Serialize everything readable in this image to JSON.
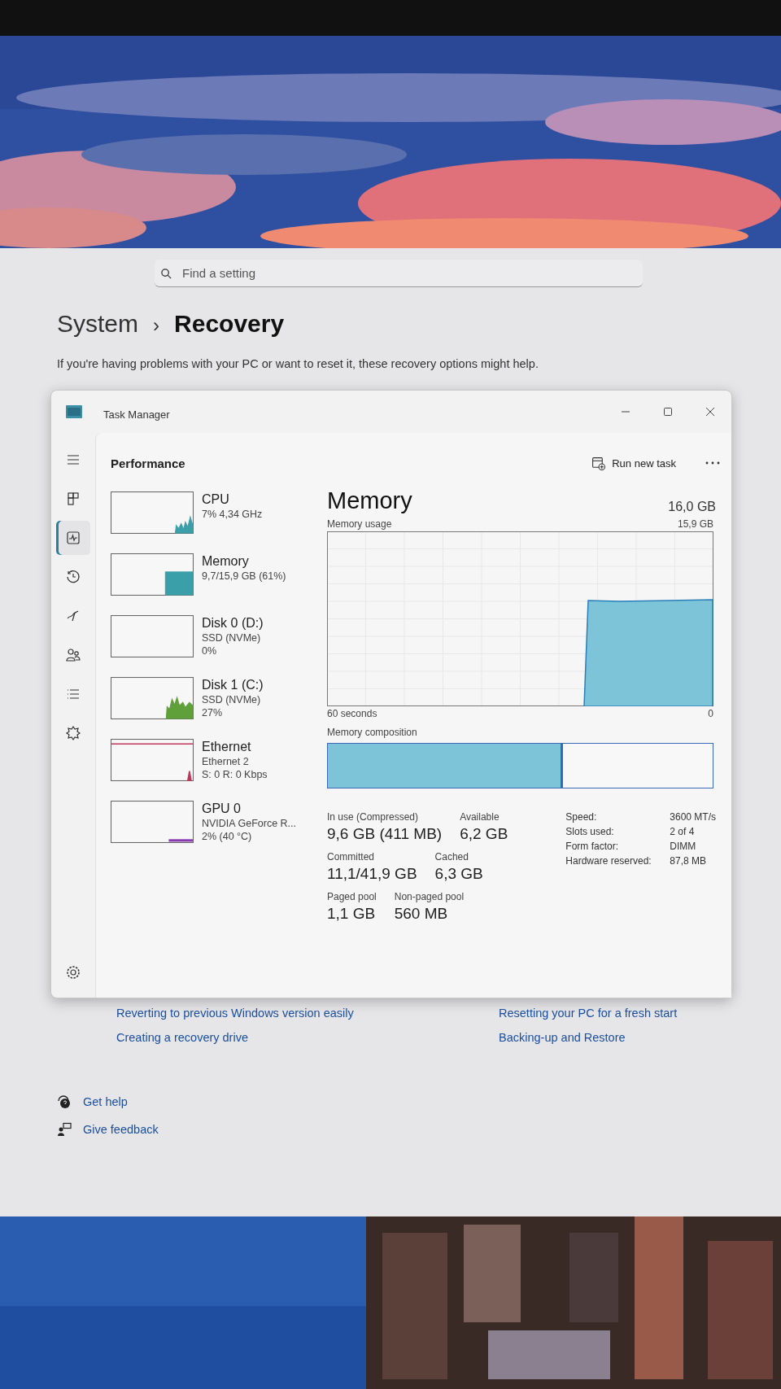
{
  "settings": {
    "search": {
      "placeholder": "Find a setting"
    },
    "breadcrumb": {
      "parent": "System",
      "separator": "›",
      "current": "Recovery"
    },
    "description": "If you're having problems with your PC or want to reset it, these recovery options might help.",
    "related_links": [
      {
        "label": "Reverting to previous Windows version easily"
      },
      {
        "label": "Resetting your PC for a fresh start"
      },
      {
        "label": "Creating a recovery drive"
      },
      {
        "label": "Backing-up and Restore"
      }
    ],
    "help_links": [
      {
        "kind": "help",
        "label": "Get help"
      },
      {
        "kind": "feedback",
        "label": "Give feedback"
      }
    ]
  },
  "task_manager": {
    "title": "Task Manager",
    "nav": [
      {
        "kind": "menu",
        "selected": false
      },
      {
        "kind": "processes",
        "selected": false
      },
      {
        "kind": "performance",
        "selected": true
      },
      {
        "kind": "history",
        "selected": false
      },
      {
        "kind": "startup",
        "selected": false
      },
      {
        "kind": "users",
        "selected": false
      },
      {
        "kind": "details",
        "selected": false
      },
      {
        "kind": "services",
        "selected": false
      }
    ],
    "nav_bottom": {
      "kind": "settings",
      "selected": false
    },
    "page_title": "Performance",
    "run_task": "Run new task",
    "resources": [
      {
        "name": "CPU",
        "lines": [
          "7% 4,34 GHz"
        ],
        "kind": "spikes",
        "color": "#3a9fa8"
      },
      {
        "name": "Memory",
        "lines": [
          "9,7/15,9 GB (61%)"
        ],
        "kind": "block",
        "color": "#3a9fa8"
      },
      {
        "name": "Disk 0 (D:)",
        "lines": [
          "SSD (NVMe)",
          "0%"
        ],
        "kind": "empty"
      },
      {
        "name": "Disk 1 (C:)",
        "lines": [
          "SSD (NVMe)",
          "27%"
        ],
        "kind": "mountain",
        "color": "#5fa03a"
      },
      {
        "name": "Ethernet",
        "lines": [
          "Ethernet 2",
          "S: 0 R: 0 Kbps"
        ],
        "kind": "blip",
        "color": "#c0385a"
      },
      {
        "name": "GPU 0",
        "lines": [
          "NVIDIA GeForce R...",
          "2% (40 °C)"
        ],
        "kind": "flat",
        "color": "#8a3ab0"
      }
    ],
    "memory_panel": {
      "title": "Memory",
      "total": "16,0 GB",
      "graph": {
        "label": "Memory usage",
        "max_label": "15,9 GB",
        "span_label": "60 seconds",
        "min_label": "0"
      },
      "composition_label": "Memory composition",
      "composition": {
        "level": 0.61
      },
      "stats": [
        [
          {
            "label": "In use (Compressed)",
            "value": "9,6 GB (411 MB)"
          },
          {
            "label": "Available",
            "value": "6,2 GB"
          }
        ],
        [
          {
            "label": "Committed",
            "value": "11,1/41,9 GB"
          },
          {
            "label": "Cached",
            "value": "6,3 GB"
          }
        ],
        [
          {
            "label": "Paged pool",
            "value": "1,1 GB"
          },
          {
            "label": "Non-paged pool",
            "value": "560 MB"
          }
        ]
      ],
      "specs": [
        {
          "label": "Speed:",
          "value": "3600 MT/s"
        },
        {
          "label": "Slots used:",
          "value": "2 of 4"
        },
        {
          "label": "Form factor:",
          "value": "DIMM"
        },
        {
          "label": "Hardware reserved:",
          "value": "87,8 MB"
        }
      ]
    }
  }
}
